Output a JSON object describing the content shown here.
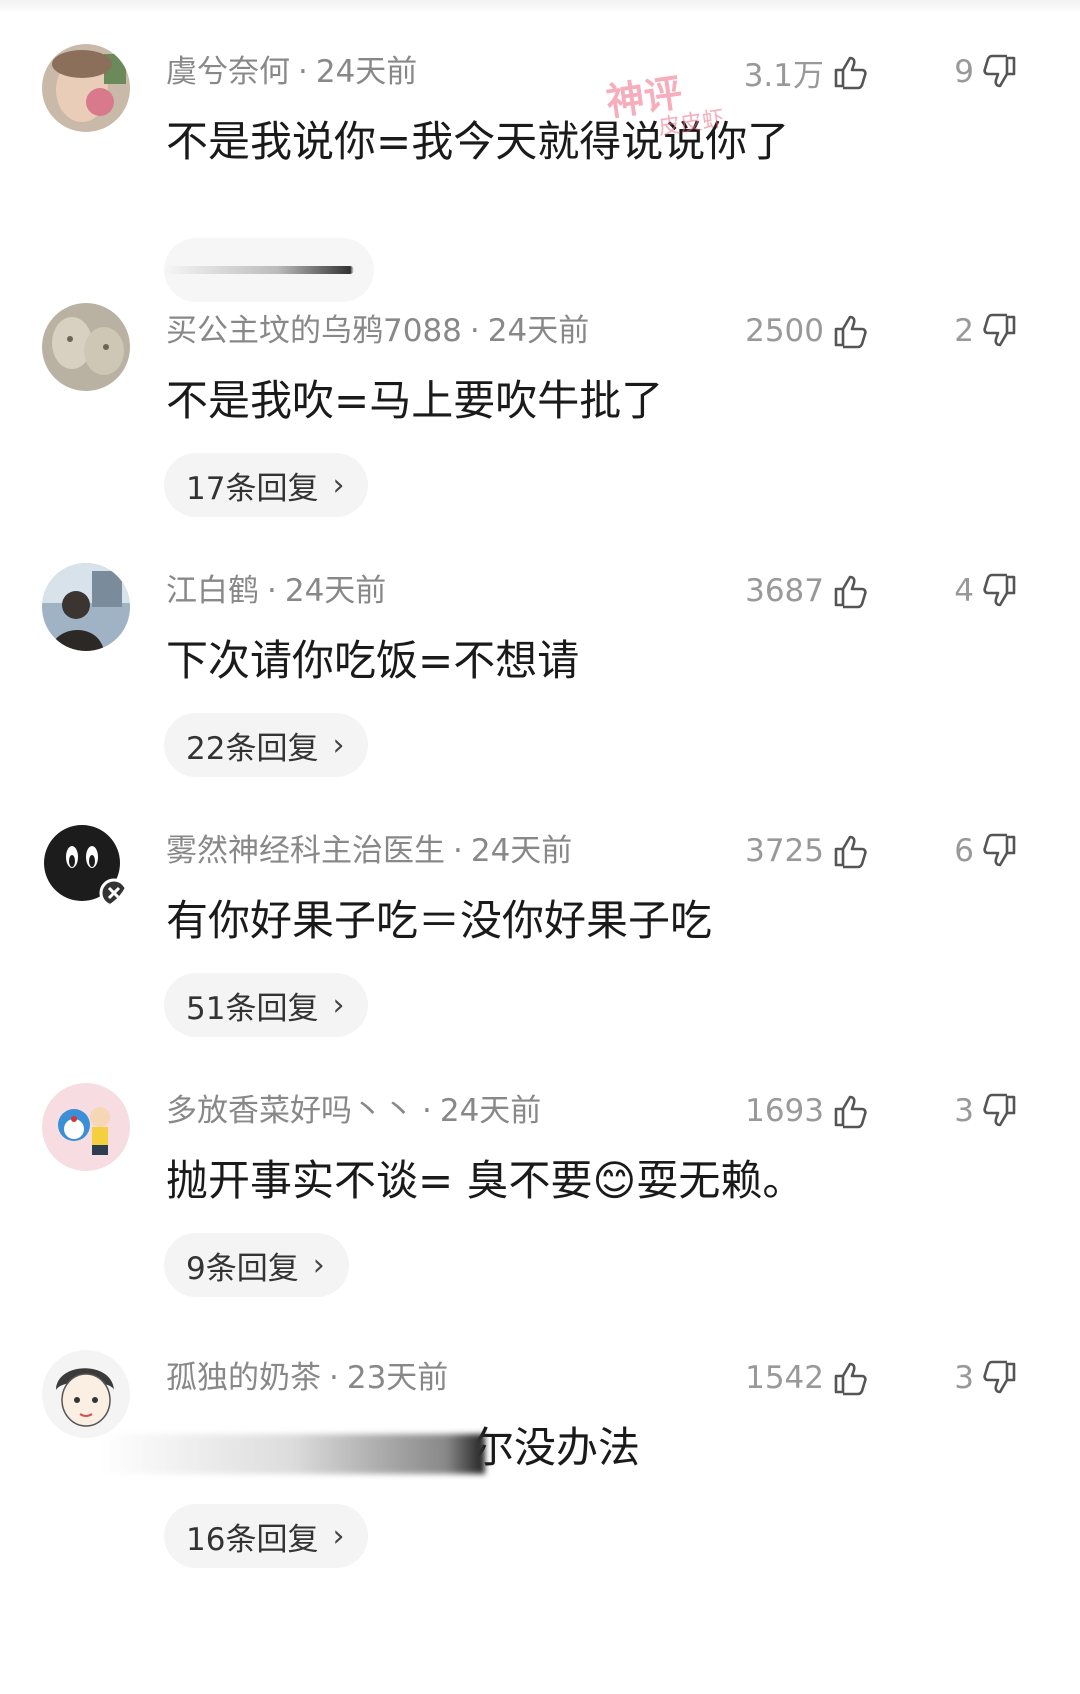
{
  "watermark": {
    "title": "神评",
    "sub": "皮皮虾"
  },
  "comments": [
    {
      "user": "虞兮奈何",
      "time": "24天前",
      "likes": "3.1万",
      "dislikes": "9",
      "text": "不是我说你=我今天就得说说你了",
      "replies": ""
    },
    {
      "user": "买公主坟的乌鸦7088",
      "time": "24天前",
      "likes": "2500",
      "dislikes": "2",
      "text": "不是我吹=马上要吹牛批了",
      "replies": "17条回复"
    },
    {
      "user": "江白鹤",
      "time": "24天前",
      "likes": "3687",
      "dislikes": "4",
      "text": "下次请你吃饭=不想请",
      "replies": "22条回复"
    },
    {
      "user": "雾然神经科主治医生",
      "time": "24天前",
      "likes": "3725",
      "dislikes": "6",
      "text": "有你好果子吃＝没你好果子吃",
      "replies": "51条回复"
    },
    {
      "user": "多放香菜好吗丶丶",
      "time": "24天前",
      "likes": "1693",
      "dislikes": "3",
      "text_a": "抛开事实不谈= 臭不要",
      "emoji": "😊",
      "text_b": "耍无赖。",
      "replies": "9条回复"
    },
    {
      "user": "孤独的奶茶",
      "time": "23天前",
      "likes": "1542",
      "dislikes": "3",
      "text": "尔没办法",
      "replies": "16条回复"
    }
  ],
  "ui": {
    "separator": "·",
    "chevron": "›"
  },
  "colors": {
    "meta": "#888888",
    "pill_bg": "#f4f4f4",
    "watermark": "#f06b86"
  }
}
